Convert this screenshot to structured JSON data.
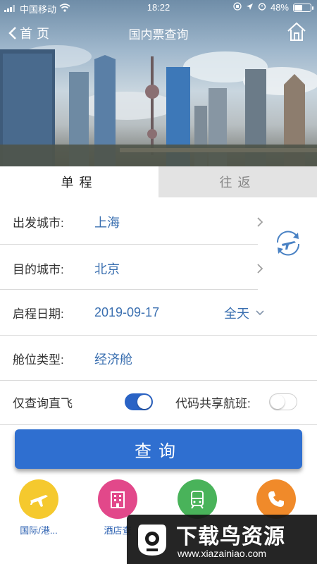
{
  "status_bar": {
    "carrier": "中国移动",
    "time": "18:22",
    "battery": "48%",
    "battery_level": 0.48
  },
  "nav": {
    "back_label": "首页",
    "title": "国内票查询"
  },
  "tabs": [
    {
      "label": "单程",
      "active": true
    },
    {
      "label": "往返",
      "active": false
    }
  ],
  "form": {
    "departure": {
      "label": "出发城市:",
      "value": "上海"
    },
    "destination": {
      "label": "目的城市:",
      "value": "北京"
    },
    "date": {
      "label": "启程日期:",
      "value": "2019-09-17",
      "time_option": "全天"
    },
    "cabin": {
      "label": "舱位类型:",
      "value": "经济舱"
    },
    "direct_only": {
      "label": "仅查询直飞",
      "enabled": true
    },
    "codeshare": {
      "label": "代码共享航班:",
      "enabled": false
    }
  },
  "search_button": "查询",
  "quick_links": [
    {
      "label": "国际/港...",
      "icon": "airplane-icon",
      "color": "#f5c92e"
    },
    {
      "label": "酒店查",
      "icon": "hotel-icon",
      "color": "#e2488a"
    },
    {
      "label": "",
      "icon": "train-icon",
      "color": "#49b35a"
    },
    {
      "label": "",
      "icon": "phone-icon",
      "color": "#f08a2a"
    }
  ],
  "watermark": {
    "title": "下载鸟资源",
    "url": "www.xiazainiao.com"
  },
  "colors": {
    "accent": "#2f6fd0",
    "link_text": "#3a6fb0",
    "tab_inactive_bg": "#e3e3e3"
  }
}
